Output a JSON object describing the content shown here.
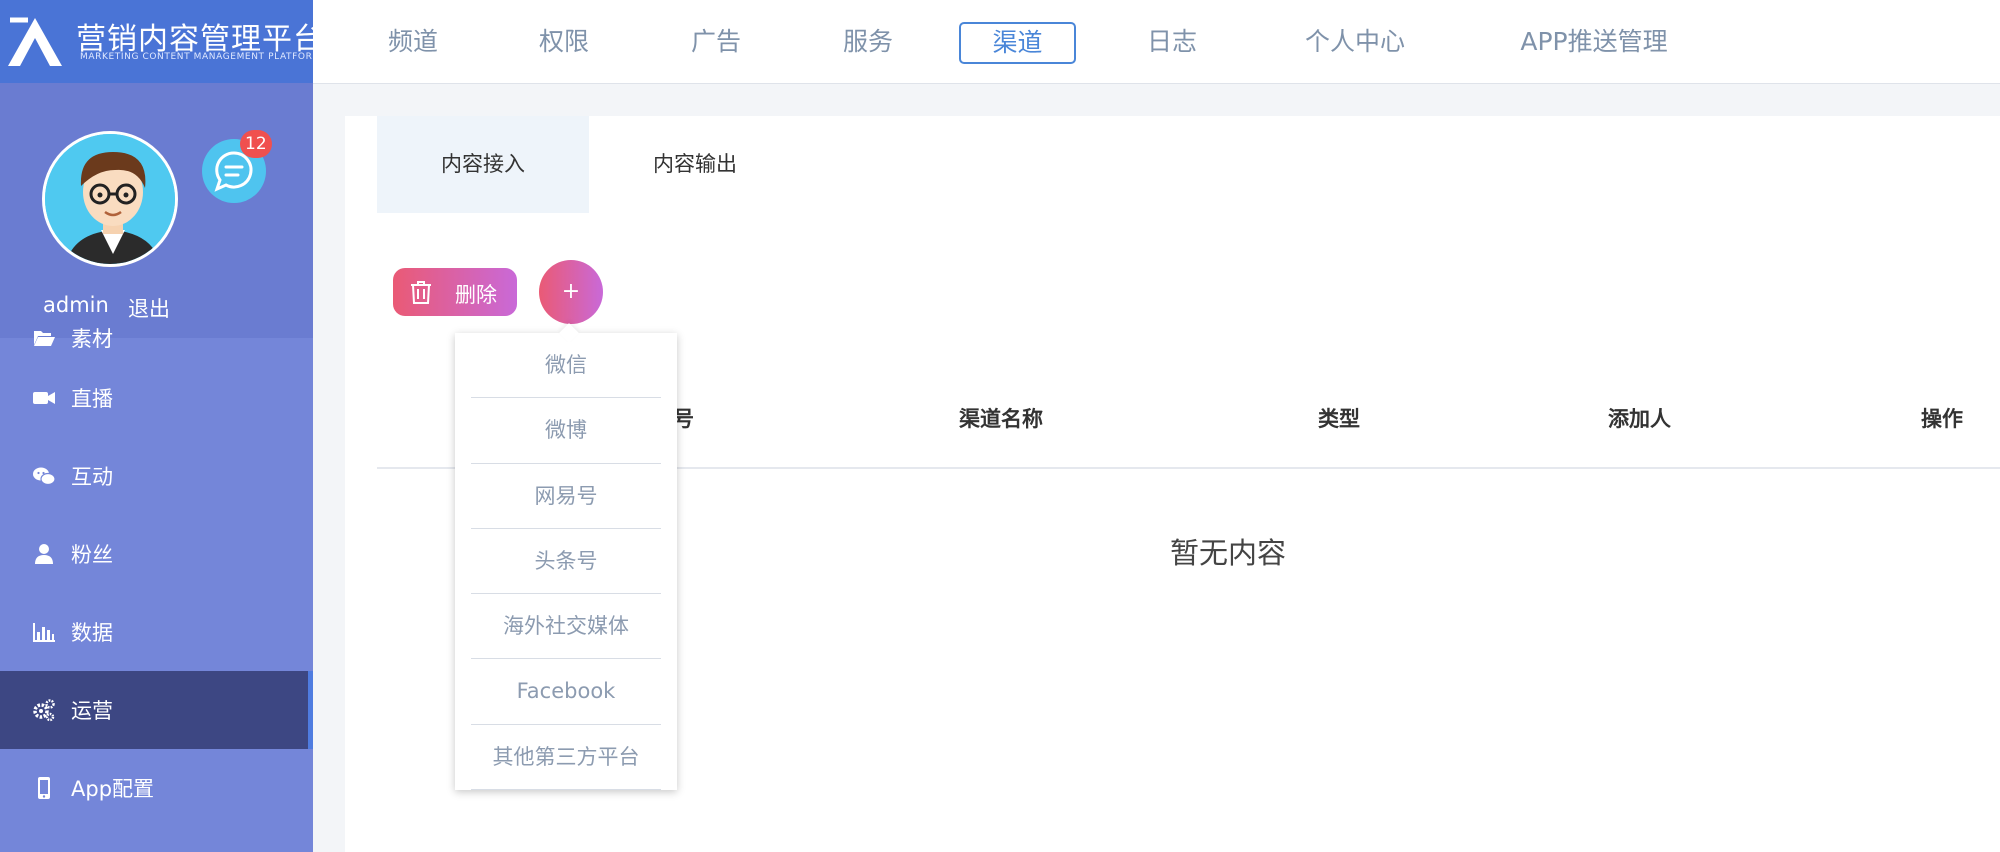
{
  "app": {
    "title": "营销内容管理平台",
    "subtitle": "MARKETING CONTENT MANAGEMENT PLATFORM"
  },
  "topnav": {
    "items": [
      {
        "label": "频道"
      },
      {
        "label": "权限"
      },
      {
        "label": "广告"
      },
      {
        "label": "服务"
      },
      {
        "label": "渠道",
        "active": true
      },
      {
        "label": "日志"
      },
      {
        "label": "个人中心"
      },
      {
        "label": "APP推送管理"
      }
    ]
  },
  "profile": {
    "username": "admin",
    "logout_label": "退出",
    "notification_count": "12"
  },
  "sidebar": {
    "items": [
      {
        "label": "素材",
        "icon": "folder-open-icon"
      },
      {
        "label": "直播",
        "icon": "video-camera-icon"
      },
      {
        "label": "互动",
        "icon": "wechat-icon"
      },
      {
        "label": "粉丝",
        "icon": "user-icon"
      },
      {
        "label": "数据",
        "icon": "bar-chart-icon"
      },
      {
        "label": "运营",
        "icon": "gears-icon",
        "active": true
      },
      {
        "label": "App配置",
        "icon": "mobile-phone-icon"
      }
    ]
  },
  "tabs": [
    {
      "label": "内容接入",
      "active": true
    },
    {
      "label": "内容输出"
    }
  ],
  "toolbar": {
    "delete_label": "删除",
    "add_label": "+"
  },
  "table": {
    "columns": [
      "号",
      "渠道名称",
      "类型",
      "添加人",
      "操作"
    ],
    "empty_text": "暂无内容"
  },
  "dropdown": {
    "items": [
      "微信",
      "微博",
      "网易号",
      "头条号",
      "海外社交媒体",
      "Facebook",
      "其他第三方平台"
    ]
  },
  "colors": {
    "header_blue": "#4a74d6",
    "sidebar": "#7486d9",
    "sidebar_active": "#3d4783",
    "accent_blue": "#4a86d8",
    "gradient_start": "#ea5a75",
    "gradient_end": "#c969d8",
    "badge_red": "#f0504f"
  }
}
